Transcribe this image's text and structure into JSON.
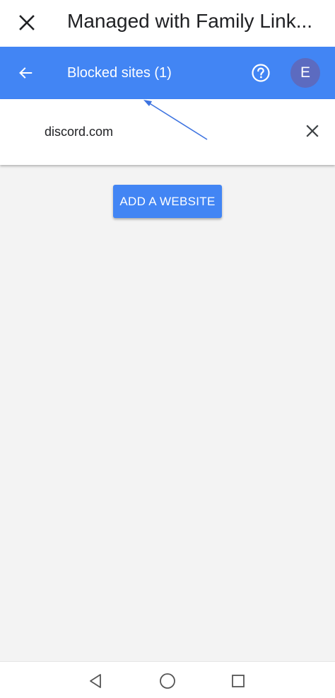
{
  "window": {
    "title": "Managed with Family Link...",
    "close_icon": "close-icon"
  },
  "appbar": {
    "title": "Blocked sites (1)",
    "back_icon": "arrow-left-icon",
    "help_icon": "help-circle-icon",
    "avatar_letter": "E",
    "color": "#4285f4",
    "avatar_color": "#5c6bc0"
  },
  "blocked_sites": [
    {
      "site": "discord.com",
      "remove_icon": "close-icon"
    }
  ],
  "actions": {
    "add_label": "ADD A WEBSITE"
  },
  "navigation": {
    "back_icon": "triangle-back-icon",
    "home_icon": "circle-home-icon",
    "recents_icon": "square-recents-icon"
  },
  "annotation": {
    "type": "arrow",
    "color": "#3d73e0"
  }
}
